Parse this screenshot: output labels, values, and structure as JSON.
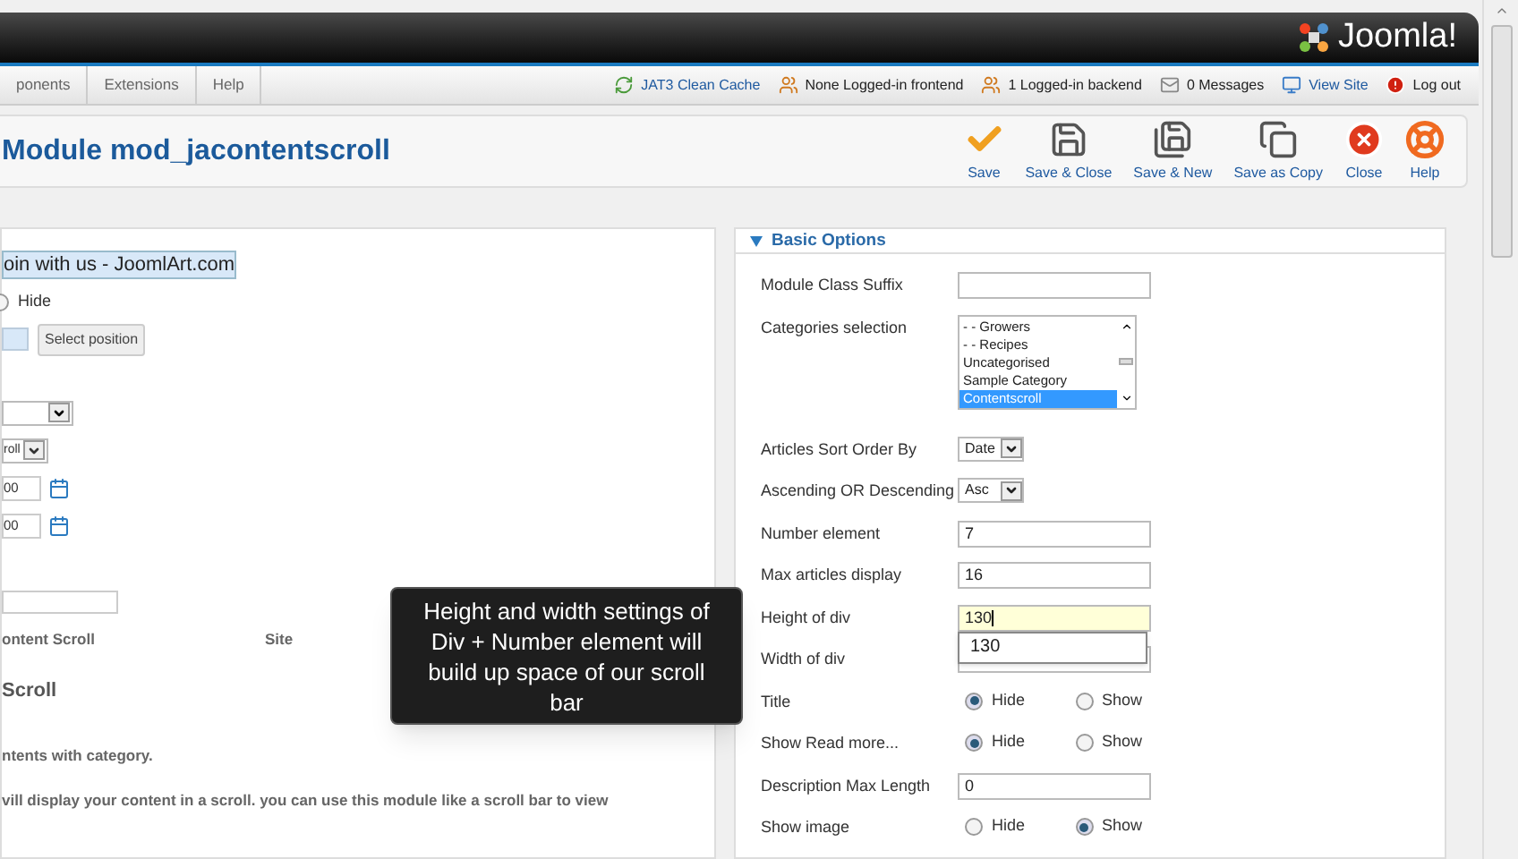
{
  "header": {
    "logo": "Joomla!"
  },
  "menu": [
    {
      "label": "ponents"
    },
    {
      "label": "Extensions"
    },
    {
      "label": "Help"
    }
  ],
  "status_links": [
    {
      "label": "JAT3 Clean Cache",
      "kind": "cache",
      "link": true
    },
    {
      "label": "None Logged-in frontend",
      "kind": "users",
      "link": false
    },
    {
      "label": "1 Logged-in backend",
      "kind": "users",
      "link": false
    },
    {
      "label": "0 Messages",
      "kind": "mail",
      "link": false
    },
    {
      "label": "View Site",
      "kind": "site",
      "link": true
    },
    {
      "label": "Log out",
      "kind": "logout",
      "link": false
    }
  ],
  "toolbar": {
    "title": "Module mod_jacontentscroll",
    "buttons": [
      {
        "label": "Save",
        "kind": "save"
      },
      {
        "label": "Save & Close",
        "kind": "save-close"
      },
      {
        "label": "Save & New",
        "kind": "save-new"
      },
      {
        "label": "Save as Copy",
        "kind": "copy"
      },
      {
        "label": "Close",
        "kind": "close"
      },
      {
        "label": "Help",
        "kind": "help"
      }
    ]
  },
  "details": {
    "title_value": "oin with us - JoomlArt.com",
    "show_title": {
      "label": "Hide",
      "selected": false
    },
    "position_button": "Select position",
    "select_2": "roll",
    "date_1": "00",
    "date_2": "00",
    "module_type": "ontent Scroll",
    "client": "Site",
    "heading": "Scroll",
    "description_1": "ntents with category.",
    "description_2": "vill display your content in a scroll. you can use this module like a scroll bar to view"
  },
  "basic_options": {
    "title": "Basic Options",
    "expanded": true,
    "fields": [
      {
        "label": "Module Class Suffix",
        "kind": "text"
      },
      {
        "label": "Categories selection",
        "kind": "list",
        "options": [
          {
            "label": "- - Growers",
            "selected": false
          },
          {
            "label": "- - Recipes",
            "selected": false
          },
          {
            "label": "Uncategorised",
            "selected": false
          },
          {
            "label": "Sample Category",
            "selected": false
          },
          {
            "label": "Contentscroll",
            "selected": true
          }
        ]
      },
      {
        "label": "Articles Sort Order By",
        "kind": "select",
        "value": "Date"
      },
      {
        "label": "Ascending OR Descending",
        "kind": "select",
        "value": "Asc"
      },
      {
        "label": "Number element",
        "kind": "text",
        "value": "7"
      },
      {
        "label": "Max articles display",
        "kind": "text",
        "value": "16"
      },
      {
        "label": "Height of div",
        "kind": "text",
        "value": "130",
        "focused": true
      },
      {
        "label": "Width of div",
        "kind": "text"
      },
      {
        "label": "Title",
        "kind": "radio",
        "options": [
          {
            "label": "Hide",
            "selected": true
          },
          {
            "label": "Show",
            "selected": false
          }
        ]
      },
      {
        "label": "Show Read more...",
        "kind": "radio",
        "options": [
          {
            "label": "Hide",
            "selected": true
          },
          {
            "label": "Show",
            "selected": false
          }
        ]
      },
      {
        "label": "Description Max Length",
        "kind": "text",
        "value": "0"
      },
      {
        "label": "Show image",
        "kind": "radio",
        "options": [
          {
            "label": "Hide",
            "selected": false
          },
          {
            "label": "Show",
            "selected": true
          }
        ]
      }
    ]
  },
  "autocomplete": [
    {
      "label": "130"
    }
  ],
  "tooltip": "Height and width settings of Div + Number element will build up space of our scroll bar"
}
